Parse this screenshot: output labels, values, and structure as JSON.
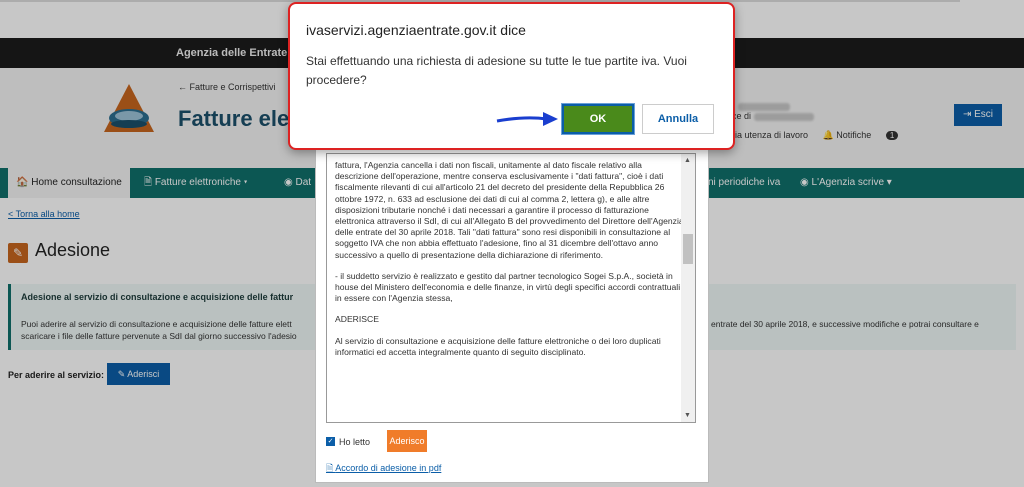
{
  "background": {
    "brand": "Agenzia delle Entrate",
    "breadcrumb": "← Fatture e Corrispettivi",
    "portal_title": "Fatture elet",
    "user_prefix": "o",
    "user_line2_prefix": "ice di",
    "links": [
      "bia utenza di lavoro",
      "Notifiche"
    ],
    "notification_count": "1",
    "esci_label": "Esci",
    "nav": [
      {
        "label": "Home consultazione",
        "icon": "home-icon"
      },
      {
        "label": "Fatture elettroniche ▾",
        "icon": "document-icon"
      },
      {
        "label": "Dat",
        "icon": "globe-icon"
      },
      {
        "label": "ni periodiche iva",
        "icon": ""
      },
      {
        "label": "L'Agenzia scrive ▾",
        "icon": "globe-icon"
      }
    ],
    "back_link": "< Torna alla home",
    "page_title": "Adesione",
    "info_head": "Adesione al servizio di consultazione e acquisizione delle fattur",
    "info_body_left": "Puoi aderire al servizio di consultazione e acquisizione delle fatture elett scaricare i file delle fatture pervenute a SdI dal giorno successivo l'adesio",
    "info_body_right": "entrate del 30 aprile 2018, e successive modifiche e potrai consultare e",
    "join_label": "Per aderire al servizio:",
    "join_button": "Aderisci"
  },
  "modal": {
    "paragraphs": [
      "fattura, l'Agenzia cancella i dati non fiscali, unitamente al dato fiscale relativo alla descrizione dell'operazione, mentre conserva esclusivamente i \"dati fattura\", cioè i dati fiscalmente rilevanti di cui all'articolo 21 del decreto del presidente della Repubblica 26 ottobre 1972, n. 633 ad esclusione dei dati di cui al comma 2, lettera g), e alle altre disposizioni tributarie nonché i dati necessari a garantire il processo di fatturazione elettronica attraverso il SdI, di cui all'Allegato B del provvedimento del Direttore dell'Agenzia delle entrate del 30 aprile 2018. Tali \"dati fattura\" sono resi disponibili in consultazione al soggetto IVA che non abbia effettuato l'adesione, fino al 31 dicembre dell'ottavo anno successivo a quello di presentazione della dichiarazione di riferimento.",
      "- il suddetto servizio è realizzato e gestito dal partner tecnologico Sogei S.p.A., società in house del Ministero dell'economia e delle finanze, in virtù degli specifici accordi contrattuali in essere con l'Agenzia stessa,",
      "ADERISCE",
      "Al servizio di consultazione e acquisizione delle fatture elettroniche o dei loro duplicati informatici ed accetta integralmente quanto di seguito disciplinato."
    ],
    "checkbox_label": "Ho letto",
    "aderisco_button": "Aderisco",
    "pdf_link": "Accordo di adesione in pdf"
  },
  "alert": {
    "origin": "ivaservizi.agenziaentrate.gov.it dice",
    "message": "Stai effettuando una richiesta di adesione su tutte le tue partite iva. Vuoi procedere?",
    "ok_label": "OK",
    "cancel_label": "Annulla"
  },
  "colors": {
    "nav_bg": "#0f6f6b",
    "primary_blue": "#0b5ea8",
    "orange": "#f07c2a",
    "alert_border": "#d22222",
    "ok_green": "#4a8a1b"
  }
}
